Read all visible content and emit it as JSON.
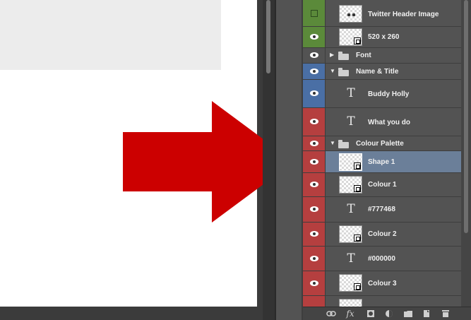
{
  "layers": [
    {
      "name": "Twitter Header Image",
      "kind": "image",
      "vis_color": "#5b8a3a",
      "visible": false
    },
    {
      "name": "520 x 260",
      "kind": "shape",
      "vis_color": "#5b8a3a",
      "visible": true
    },
    {
      "name": "Font",
      "kind": "group-collapsed",
      "vis_color": "#535353",
      "visible": true
    },
    {
      "name": "Name & Title",
      "kind": "group-open",
      "vis_color": "#4a6fa5",
      "visible": true
    },
    {
      "name": "Buddy Holly",
      "kind": "text",
      "vis_color": "#4a6fa5",
      "visible": true
    },
    {
      "name": "What you do",
      "kind": "text",
      "vis_color": "#b53f3f",
      "visible": true
    },
    {
      "name": "Colour Palette",
      "kind": "group-open",
      "vis_color": "#b53f3f",
      "visible": true
    },
    {
      "name": "Shape 1",
      "kind": "shape",
      "vis_color": "#b53f3f",
      "visible": true,
      "selected": true
    },
    {
      "name": "Colour 1",
      "kind": "shape",
      "vis_color": "#b53f3f",
      "visible": true
    },
    {
      "name": "#777468",
      "kind": "text",
      "vis_color": "#b53f3f",
      "visible": true
    },
    {
      "name": "Colour 2",
      "kind": "shape",
      "vis_color": "#b53f3f",
      "visible": true
    },
    {
      "name": "#000000",
      "kind": "text",
      "vis_color": "#b53f3f",
      "visible": true
    },
    {
      "name": "Colour 3",
      "kind": "shape",
      "vis_color": "#b53f3f",
      "visible": true
    }
  ],
  "text_glyph": "T",
  "bottom_bar": {
    "link_icon": "link-icon",
    "fx_label": "fx",
    "mask_icon": "mask-icon",
    "adjustment_icon": "adjustment-icon",
    "folder_icon": "new-group-icon",
    "new_layer_icon": "new-layer-icon",
    "trash_icon": "trash-icon"
  },
  "colors": {
    "arrow": "#cc0000",
    "selection": "#6b7f99",
    "panel": "#535353"
  }
}
